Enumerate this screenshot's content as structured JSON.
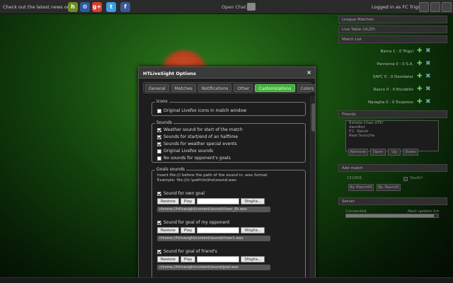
{
  "topbar": {
    "news_text": "Check out the latest news on",
    "social_icons": [
      "hattrick-icon",
      "blogger-icon",
      "googleplus-icon",
      "twitter-icon",
      "facebook-icon"
    ],
    "open_chat": "Open Chat",
    "logged": "Logged in as FC Trigul"
  },
  "dialog": {
    "title": "HTLiveSight Options",
    "close": "×",
    "tabs": [
      "General",
      "Matches",
      "Notifications",
      "Other",
      "Customizations",
      "Colors"
    ],
    "active_tab": "Customizations",
    "icons": {
      "legend": "Icons",
      "items": [
        {
          "label": "Original Livefox icons in match window",
          "checked": false
        }
      ]
    },
    "sounds": {
      "legend": "Sounds",
      "items": [
        {
          "label": "Weather sound for start of the match",
          "checked": true
        },
        {
          "label": "Sounds for start/end of an halftime",
          "checked": true
        },
        {
          "label": "Sounds for weather special events",
          "checked": true
        },
        {
          "label": "Original Livefox sounds",
          "checked": false
        },
        {
          "label": "No sounds for opponent's goals",
          "checked": false
        }
      ]
    },
    "goals": {
      "legend": "Goals sounds",
      "info1": "Insert file:/// before the path of the sound in .wav format",
      "info2": "Example: file:///c:\\path\\to\\the\\sound.wav",
      "restore": "Restore",
      "play": "Play",
      "browse": "Sfoglia...",
      "entries": [
        {
          "label": "Sound for own goal",
          "path": "chrome://htlivesight/content/sound/cheer_8k.wav"
        },
        {
          "label": "Sound for goal of my opponent",
          "path": "chrome://htlivesight/content/sound/cheer1.wav"
        },
        {
          "label": "Sound for goal of friend's",
          "path": "chrome://htlivesight/content/sound/goal.wav"
        }
      ]
    }
  },
  "sidebar": {
    "league_matches": "League Matches",
    "league_table": "Live Table (VLZP)",
    "match_list_title": "Match List",
    "match_list": [
      "Barca 1 : 0 Trigul",
      "Pannonia 0 : 0 S.A.",
      "SAFC 0 : 0 Davidator",
      "Rasco 0 : 0 Escobillo",
      "Naragha 0 : 0 Exxpress"
    ],
    "friends_title": "Friends",
    "friends": [
      "Estrela Chao UTD",
      "davidtor",
      "F.C. Ratuli",
      "Real Suruche"
    ],
    "friend_buttons": [
      "Remove",
      "Open",
      "Up",
      "Down"
    ],
    "add_match_title": "Add match",
    "add_match_id": "151856",
    "youth_label": "Youth?",
    "add_buttons": [
      "By MatchID",
      "By TeamID"
    ],
    "server_title": "Server",
    "connected": "Connected",
    "next_update": "Next update:1m",
    "progress": 0.95
  }
}
